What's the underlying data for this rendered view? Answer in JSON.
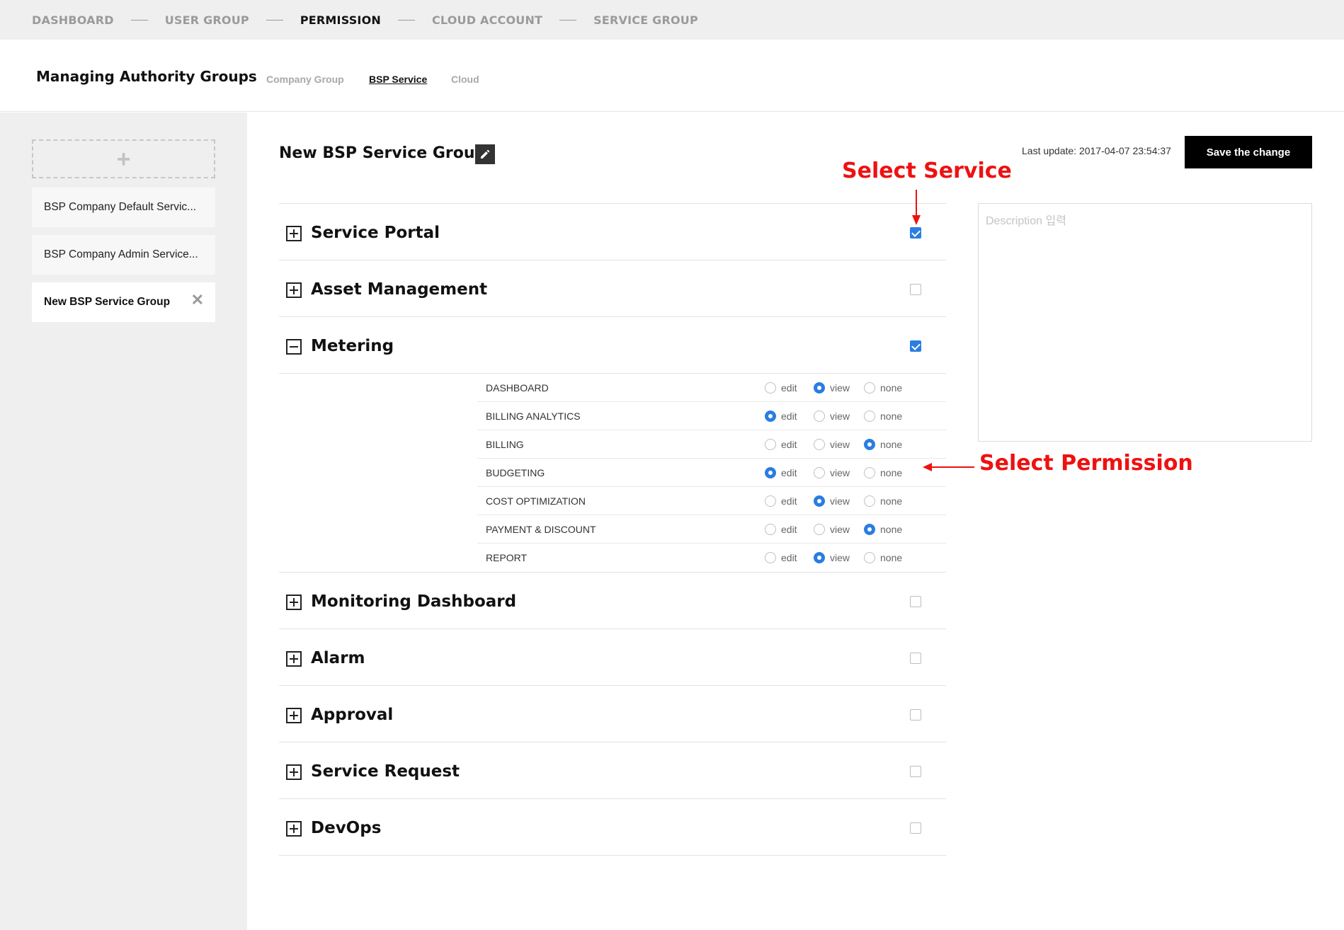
{
  "steps": [
    "DASHBOARD",
    "USER GROUP",
    "PERMISSION",
    "CLOUD ACCOUNT",
    "SERVICE GROUP"
  ],
  "active_step": "PERMISSION",
  "header": {
    "title": "Managing Authority Groups",
    "tabs": [
      "Company Group",
      "BSP Service",
      "Cloud"
    ],
    "active_tab": "BSP Service"
  },
  "sidebar": {
    "add_icon": "plus-icon",
    "groups": [
      "BSP Company Default Servic...",
      "BSP Company Admin Service...",
      "New BSP Service Group"
    ],
    "active_group": "New BSP Service Group",
    "close_icon": "close-icon"
  },
  "main": {
    "group_title": "New BSP Service Group",
    "edit_icon": "pencil-icon",
    "last_update": "Last update: 2017-04-07 23:54:37",
    "save_label": "Save the change",
    "description_placeholder": "Description 입력",
    "services": [
      {
        "name": "Service Portal",
        "checked": true,
        "expanded": false
      },
      {
        "name": "Asset Management",
        "checked": false,
        "expanded": false
      },
      {
        "name": "Metering",
        "checked": true,
        "expanded": true
      },
      {
        "name": "Monitoring Dashboard",
        "checked": false,
        "expanded": false
      },
      {
        "name": "Alarm",
        "checked": false,
        "expanded": false
      },
      {
        "name": "Approval",
        "checked": false,
        "expanded": false
      },
      {
        "name": "Service Request",
        "checked": false,
        "expanded": false
      },
      {
        "name": "DevOps",
        "checked": false,
        "expanded": false
      }
    ],
    "permission_options": [
      "edit",
      "view",
      "none"
    ],
    "metering_permissions": [
      {
        "name": "DASHBOARD",
        "value": "view"
      },
      {
        "name": "BILLING ANALYTICS",
        "value": "edit"
      },
      {
        "name": "BILLING",
        "value": "none"
      },
      {
        "name": "BUDGETING",
        "value": "edit"
      },
      {
        "name": "COST OPTIMIZATION",
        "value": "view"
      },
      {
        "name": "PAYMENT & DISCOUNT",
        "value": "none"
      },
      {
        "name": "REPORT",
        "value": "view"
      }
    ]
  },
  "annotations": {
    "select_service": "Select Service",
    "select_permission": "Select Permission",
    "color": "#ee1111"
  },
  "colors": {
    "accent": "#2a7de1",
    "save_button": "#000000",
    "sidebar_bg": "#efefef"
  }
}
